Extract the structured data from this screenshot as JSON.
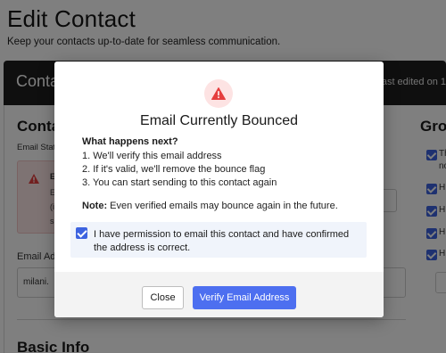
{
  "page": {
    "title": "Edit Contact",
    "subtitle": "Keep your contacts up-to-date for seamless communication."
  },
  "contact_header": {
    "title": "Conta",
    "last_edited": "Last edited on 1"
  },
  "contact_section": {
    "title": "Conta",
    "email_status_label": "Email Stat",
    "alert_heading": "E",
    "alert_lines": [
      "E",
      "(i",
      "s"
    ],
    "email_address_label": "Email Ad",
    "email_value": "milani."
  },
  "groups": {
    "title": "Grou",
    "items": [
      "Th",
      "no",
      "H",
      "H",
      "H",
      "H"
    ]
  },
  "basic_info": {
    "title": "Basic Info"
  },
  "modal": {
    "title": "Email Currently Bounced",
    "what_next_heading": "What happens next?",
    "steps": [
      "1. We'll verify this email address",
      "2. If it's valid, we'll remove the bounce flag",
      "3. You can start sending to this contact again"
    ],
    "note_label": "Note:",
    "note_text": " Even verified emails may bounce again in the future.",
    "permission_text": "I have permission to email this contact and have confirmed the address is correct.",
    "permission_checked": true,
    "close_label": "Close",
    "verify_label": "Verify Email Address",
    "icon": "warning-triangle-icon"
  },
  "colors": {
    "accent": "#4d6ff0",
    "warning": "#e53e3e",
    "warning_bg": "#fde3e3",
    "header_bg": "#1f1f1f"
  }
}
